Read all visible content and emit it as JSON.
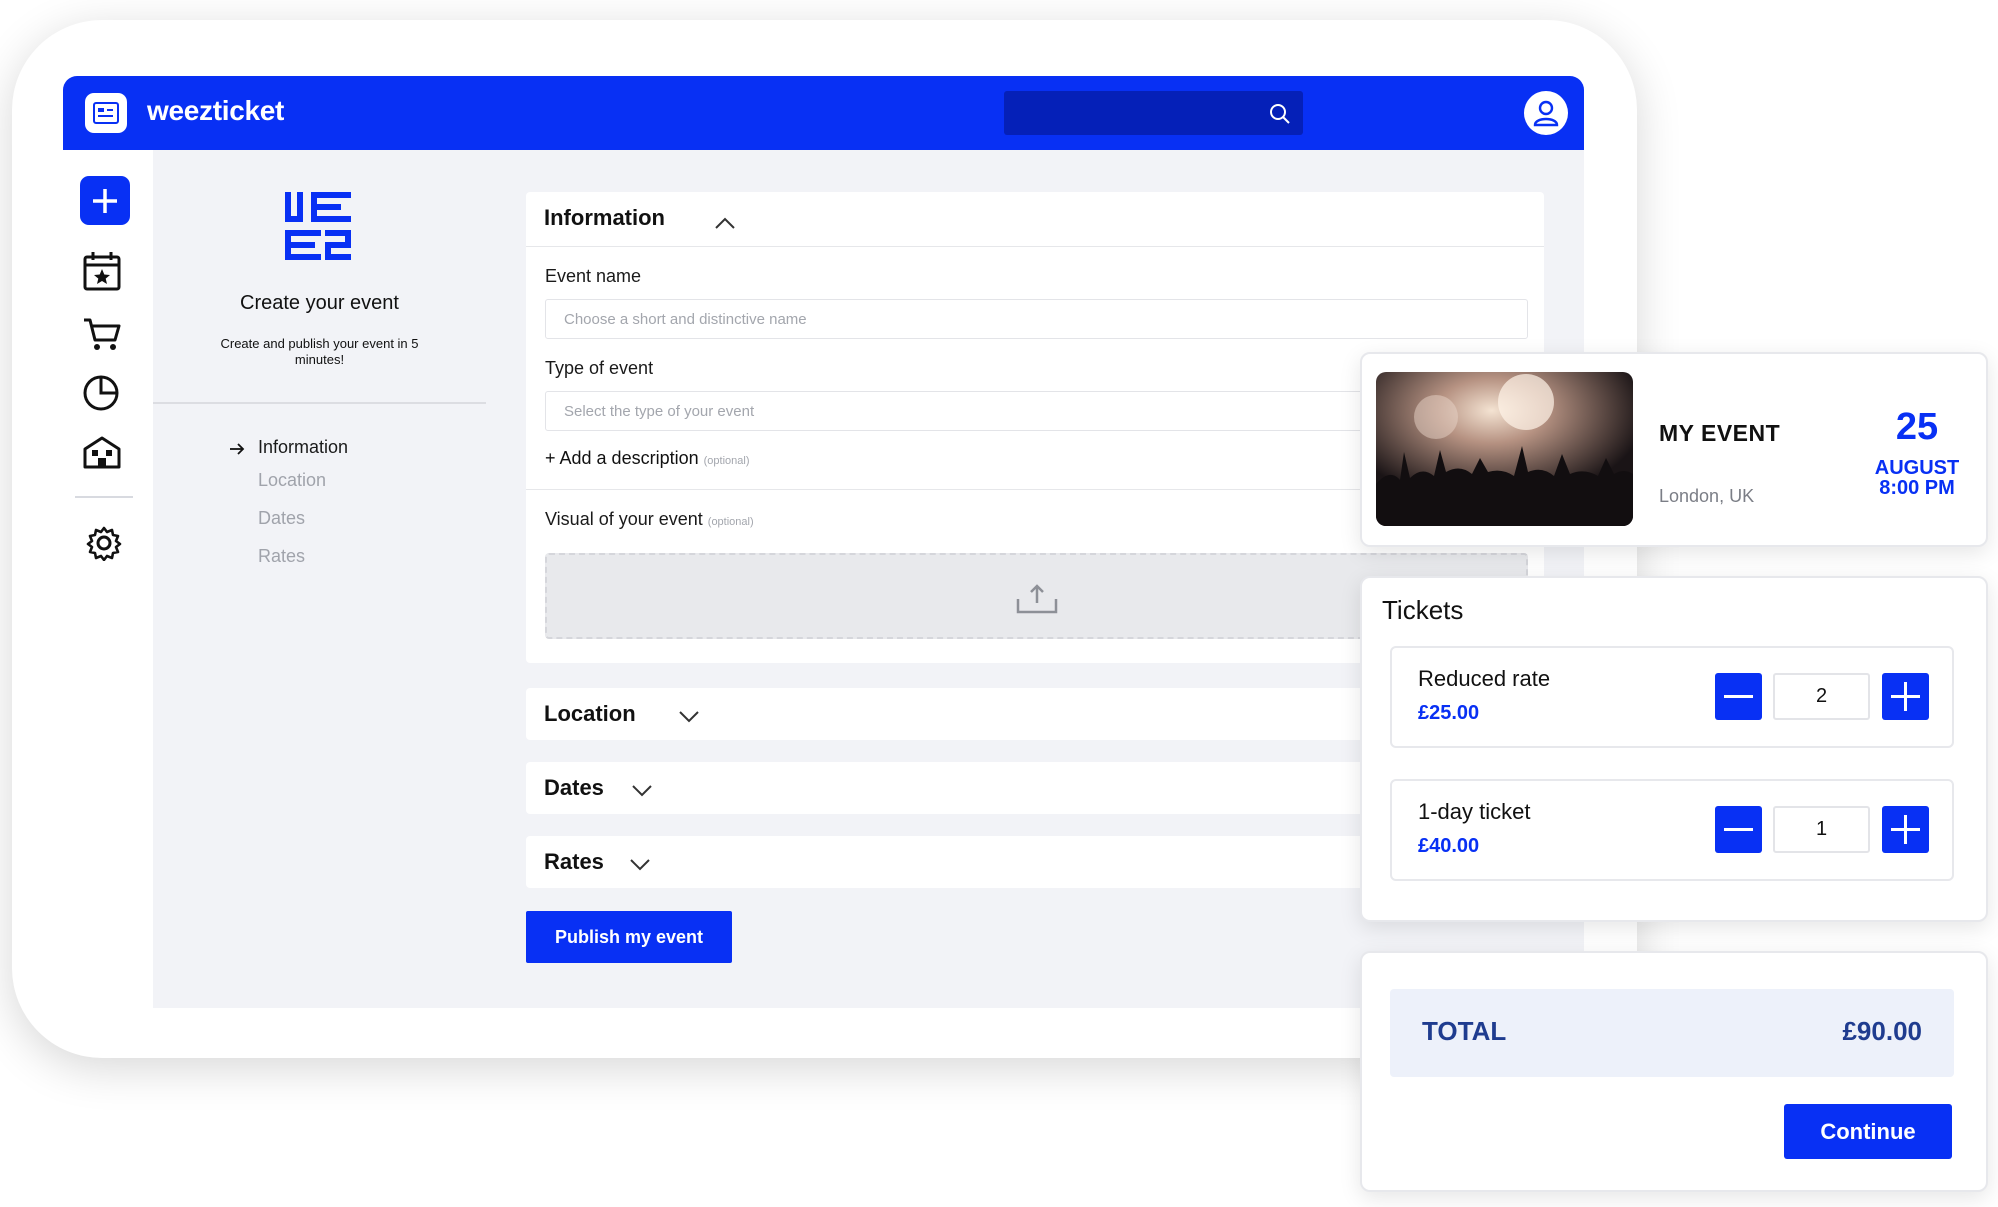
{
  "header": {
    "brand": "weezticket",
    "search": {
      "value": ""
    }
  },
  "rail": {
    "items": [
      {
        "name": "add",
        "icon": "plus-icon"
      },
      {
        "name": "events",
        "icon": "calendar-star-icon"
      },
      {
        "name": "sales",
        "icon": "cart-icon"
      },
      {
        "name": "statistics",
        "icon": "pie-chart-icon"
      },
      {
        "name": "venues",
        "icon": "building-icon"
      },
      {
        "name": "settings",
        "icon": "gear-icon"
      }
    ]
  },
  "steps_panel": {
    "title": "Create your event",
    "subtitle": "Create and publish your event in 5 minutes!",
    "steps": [
      {
        "label": "Information",
        "active": true
      },
      {
        "label": "Location",
        "active": false
      },
      {
        "label": "Dates",
        "active": false
      },
      {
        "label": "Rates",
        "active": false
      }
    ]
  },
  "form": {
    "information": {
      "title": "Information",
      "event_name_label": "Event name",
      "event_name_placeholder": "Choose a short and distinctive name",
      "type_label": "Type of event",
      "type_placeholder": "Select the type of your event",
      "add_description": "+ Add a description",
      "optional": "(optional)",
      "visual_label": "Visual of your event"
    },
    "sections": [
      {
        "title": "Location"
      },
      {
        "title": "Dates"
      },
      {
        "title": "Rates"
      }
    ],
    "publish_label": "Publish my event"
  },
  "event_card": {
    "name": "MY EVENT",
    "location": "London, UK",
    "day": "25",
    "month": "AUGUST",
    "time": "8:00 PM"
  },
  "tickets": {
    "title": "Tickets",
    "items": [
      {
        "name": "Reduced rate",
        "price": "£25.00",
        "quantity": "2"
      },
      {
        "name": "1-day ticket",
        "price": "£40.00",
        "quantity": "1"
      }
    ]
  },
  "checkout": {
    "total_label": "TOTAL",
    "total_value": "£90.00",
    "continue_label": "Continue"
  },
  "colors": {
    "accent": "#0830f4",
    "panel_bg": "#f2f3f7",
    "total_text": "#1f3c8f"
  }
}
